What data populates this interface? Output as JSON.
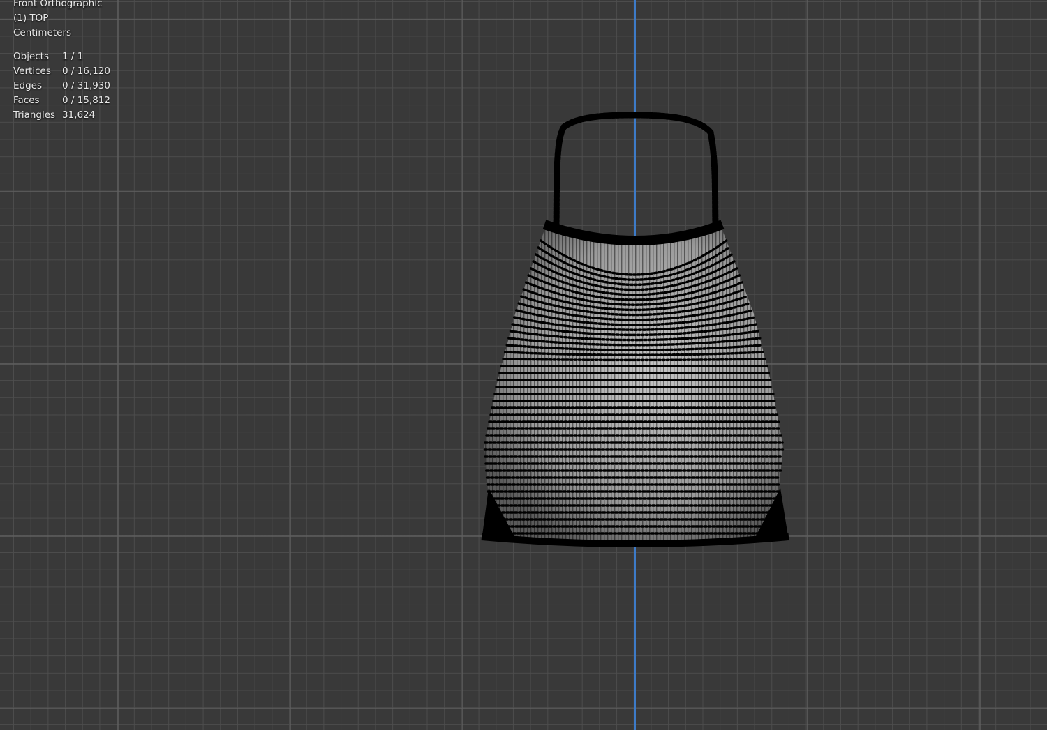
{
  "viewport": {
    "view_name": "Front Orthographic",
    "collection_object": "(1) TOP",
    "units": "Centimeters",
    "axis_color": "#3d7bc8",
    "background_color": "#393939"
  },
  "stats": [
    {
      "label": "Objects",
      "value": "1 / 1"
    },
    {
      "label": "Vertices",
      "value": "0 / 16,120"
    },
    {
      "label": "Edges",
      "value": "0 / 31,930"
    },
    {
      "label": "Faces",
      "value": "0 / 15,812"
    },
    {
      "label": "Triangles",
      "value": "31,624"
    }
  ]
}
